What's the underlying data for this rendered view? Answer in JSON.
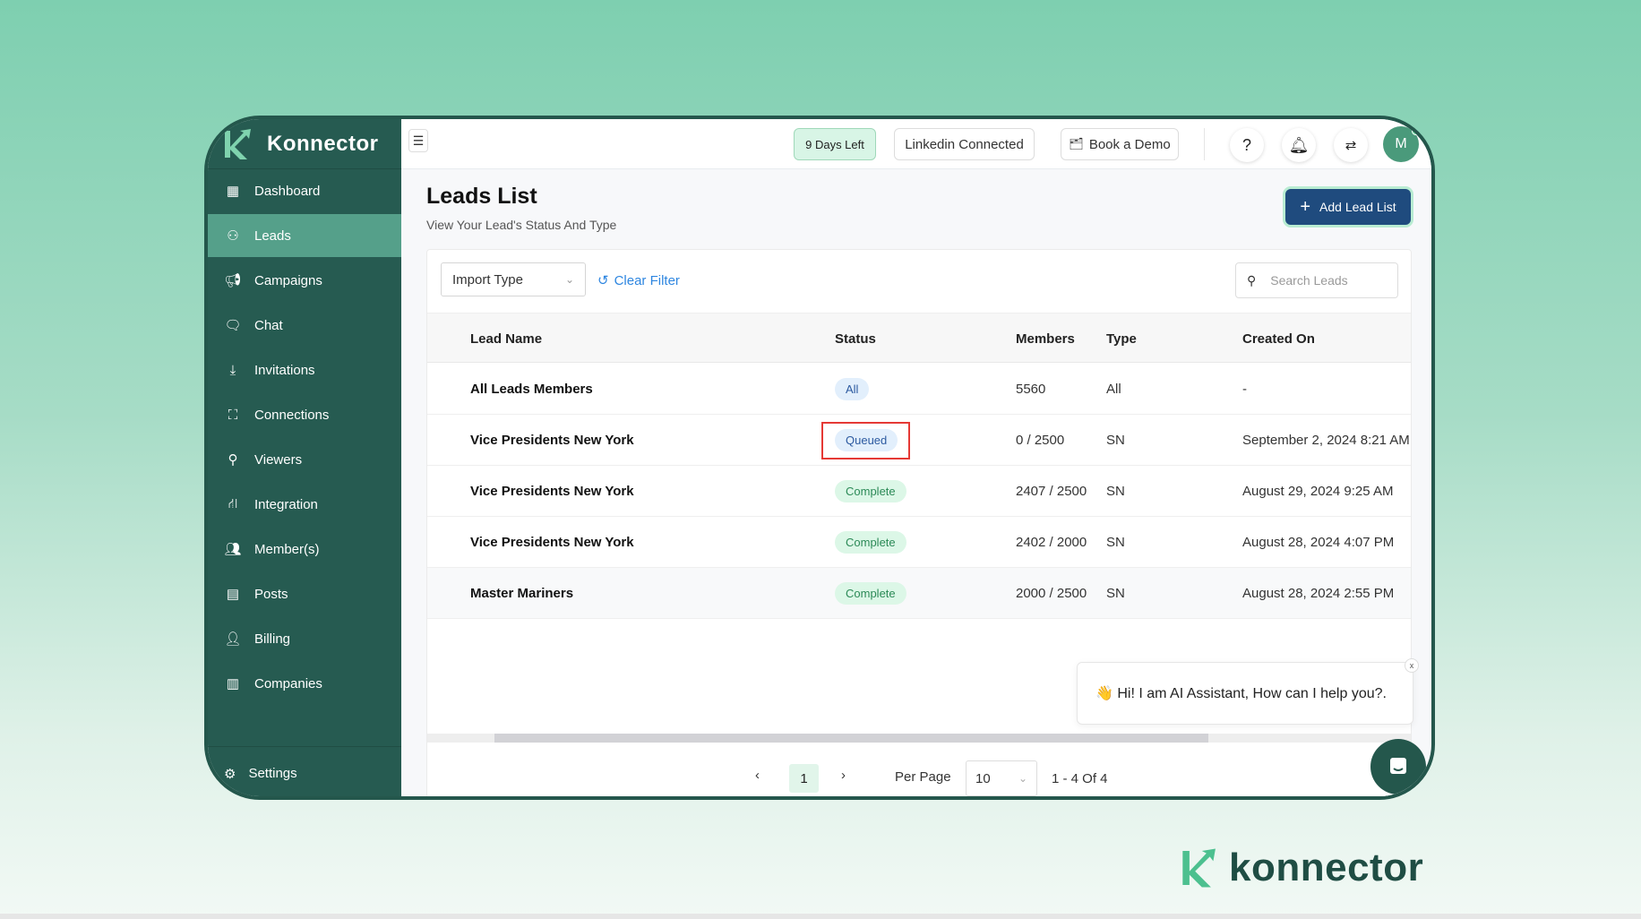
{
  "app": {
    "brand": "Konnector",
    "bottom_logo": "konnector"
  },
  "colors": {
    "sidebar": "#265b51",
    "active": "#55a08a",
    "primary_button": "#1f4b7e",
    "link": "#2e86e0"
  },
  "sidebar": {
    "items": [
      {
        "label": "Dashboard",
        "icon": "dashboard-icon"
      },
      {
        "label": "Leads",
        "icon": "leads-icon",
        "active": true
      },
      {
        "label": "Campaigns",
        "icon": "megaphone-icon"
      },
      {
        "label": "Chat",
        "icon": "chat-icon"
      },
      {
        "label": "Invitations",
        "icon": "inbox-icon"
      },
      {
        "label": "Connections",
        "icon": "connections-icon"
      },
      {
        "label": "Viewers",
        "icon": "viewers-icon"
      },
      {
        "label": "Integration",
        "icon": "integration-icon"
      },
      {
        "label": "Member(s)",
        "icon": "members-icon"
      },
      {
        "label": "Posts",
        "icon": "posts-icon"
      },
      {
        "label": "Billing",
        "icon": "billing-icon"
      },
      {
        "label": "Companies",
        "icon": "companies-icon"
      }
    ],
    "settings": "Settings"
  },
  "topbar": {
    "trial": "9 Days Left",
    "linkedin": "Linkedin Connected",
    "demo": "Book a Demo",
    "avatar": "M"
  },
  "page": {
    "title": "Leads List",
    "subtitle": "View Your Lead's Status And Type",
    "add_button": "Add Lead List"
  },
  "filters": {
    "import_type": "Import Type",
    "clear": "Clear Filter",
    "search_placeholder": "Search Leads"
  },
  "table": {
    "headers": [
      "Lead Name",
      "Status",
      "Members",
      "Type",
      "Created On"
    ],
    "rows": [
      {
        "name": "All Leads Members",
        "status": "All",
        "members": "5560",
        "type": "All",
        "created": "-"
      },
      {
        "name": "Vice Presidents New York",
        "status": "Queued",
        "members": "0 / 2500",
        "type": "SN",
        "created": "September 2, 2024 8:21 AM"
      },
      {
        "name": "Vice Presidents New York",
        "status": "Complete",
        "members": "2407 / 2500",
        "type": "SN",
        "created": "August 29, 2024 9:25 AM"
      },
      {
        "name": "Vice Presidents New York",
        "status": "Complete",
        "members": "2402 / 2000",
        "type": "SN",
        "created": "August 28, 2024 4:07 PM"
      },
      {
        "name": "Master Mariners",
        "status": "Complete",
        "members": "2000 / 2500",
        "type": "SN",
        "created": "August 28, 2024 2:55 PM"
      }
    ]
  },
  "pagination": {
    "prev": "‹",
    "page": "1",
    "next": "›",
    "per_page_label": "Per Page",
    "per_page": "10",
    "range": "1 - 4 Of 4"
  },
  "chat": {
    "message": "👋 Hi! I am AI Assistant, How can I help you?.",
    "close": "x"
  }
}
